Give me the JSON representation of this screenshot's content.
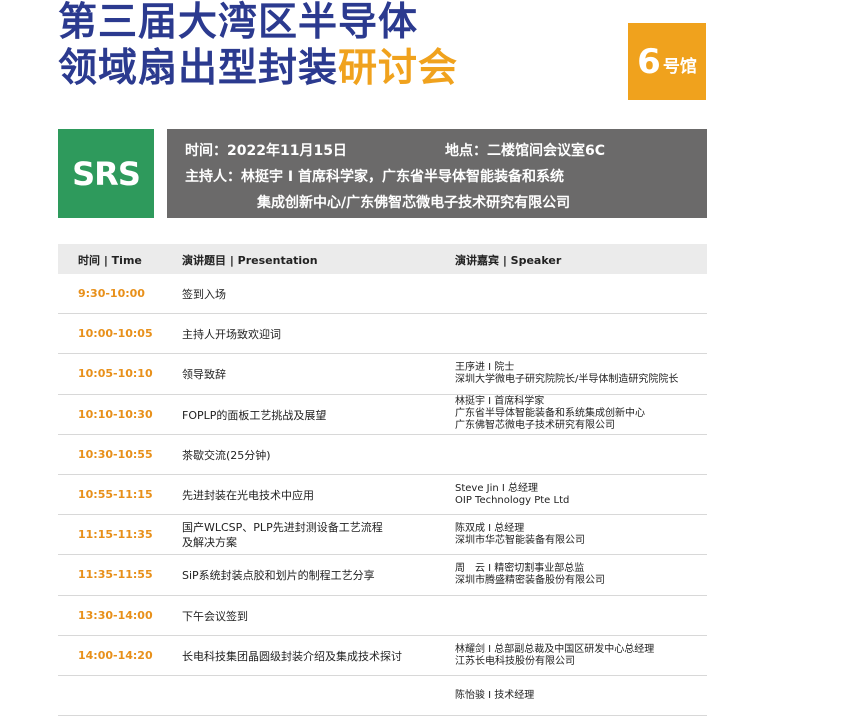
{
  "title": {
    "line1": "第三届大湾区半导体",
    "line2_main": "领域扇出型封装",
    "line2_accent": "研讨会"
  },
  "hall_badge": {
    "number": "6",
    "text": "号馆"
  },
  "logo": {
    "text": "SRS"
  },
  "info": {
    "time": "时间：2022年11月15日",
    "location": "地点：二楼馆间会议室6C",
    "host_line1": "主持人：林挺宇 I 首席科学家，广东省半导体智能装备和系统",
    "host_line2": "集成创新中心/广东佛智芯微电子技术研究有限公司"
  },
  "table": {
    "headers": {
      "time": "时间 | Time",
      "presentation": "演讲题目 | Presentation",
      "speaker": "演讲嘉宾 | Speaker"
    },
    "rows": [
      {
        "time": "9:30-10:00",
        "presentation": [
          "签到入场"
        ],
        "speaker": []
      },
      {
        "time": "10:00-10:05",
        "presentation": [
          "主持人开场致欢迎词"
        ],
        "speaker": []
      },
      {
        "time": "10:05-10:10",
        "presentation": [
          "领导致辞"
        ],
        "speaker": [
          "王序进 I 院士",
          "深圳大学微电子研究院院长/半导体制造研究院院长"
        ]
      },
      {
        "time": "10:10-10:30",
        "presentation": [
          "FOPLP的面板工艺挑战及展望"
        ],
        "speaker": [
          "林挺宇 I 首席科学家",
          "广东省半导体智能装备和系统集成创新中心",
          "广东佛智芯微电子技术研究有限公司"
        ]
      },
      {
        "time": "10:30-10:55",
        "presentation": [
          "茶歇交流(25分钟)"
        ],
        "speaker": []
      },
      {
        "time": "10:55-11:15",
        "presentation": [
          "先进封装在光电技术中应用"
        ],
        "speaker": [
          "Steve Jin I 总经理",
          "OIP Technology Pte Ltd"
        ]
      },
      {
        "time": "11:15-11:35",
        "presentation": [
          "国产WLCSP、PLP先进封测设备工艺流程",
          "及解决方案"
        ],
        "speaker": [
          "陈双成 I 总经理",
          "深圳市华芯智能装备有限公司"
        ]
      },
      {
        "time": "11:35-11:55",
        "presentation": [
          "SiP系统封装点胶和划片的制程工艺分享"
        ],
        "speaker": [
          "周　云 I 精密切割事业部总监",
          "深圳市腾盛精密装备股份有限公司"
        ]
      },
      {
        "time": "13:30-14:00",
        "presentation": [
          "下午会议签到"
        ],
        "speaker": []
      },
      {
        "time": "14:00-14:20",
        "presentation": [
          "长电科技集团晶圆级封装介绍及集成技术探讨"
        ],
        "speaker": [
          "林耀剑 I 总部副总裁及中国区研发中心总经理",
          "江苏长电科技股份有限公司"
        ]
      },
      {
        "time": "",
        "presentation": [],
        "speaker": [
          "陈怡骏 I 技术经理"
        ]
      }
    ]
  }
}
